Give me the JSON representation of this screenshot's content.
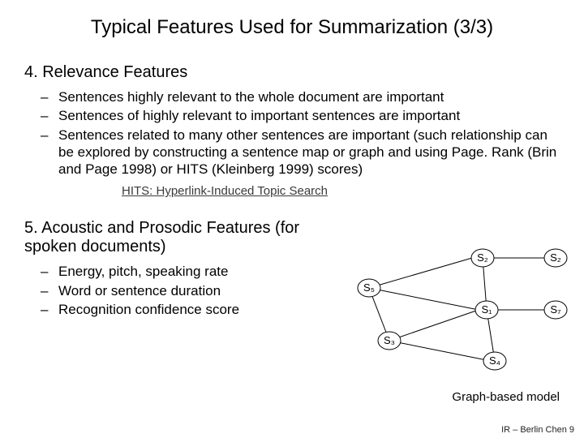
{
  "title": "Typical Features Used for Summarization (3/3)",
  "section4": {
    "heading": "4. Relevance Features",
    "bullets": [
      "Sentences highly relevant to the whole document are important",
      "Sentences of highly relevant to important sentences are important",
      "Sentences related to many other sentences are important (such relationship can be explored by constructing a sentence map or graph and using Page. Rank (Brin and Page 1998) or HITS (Kleinberg 1999) scores)"
    ],
    "hits_note": "HITS:  Hyperlink-Induced  Topic Search"
  },
  "section5": {
    "heading": "5. Acoustic and Prosodic Features (for spoken documents)",
    "bullets": [
      "Energy, pitch, speaking rate",
      "Word or sentence duration",
      "Recognition confidence score"
    ]
  },
  "graph": {
    "caption": "Graph-based model",
    "nodes": {
      "s5": "S₅",
      "s2": "S₂",
      "s2b": "S₂",
      "s1": "S₁",
      "s3": "S₃",
      "s7": "S₇",
      "s4": "S₄"
    }
  },
  "footer": "IR – Berlin Chen 9"
}
